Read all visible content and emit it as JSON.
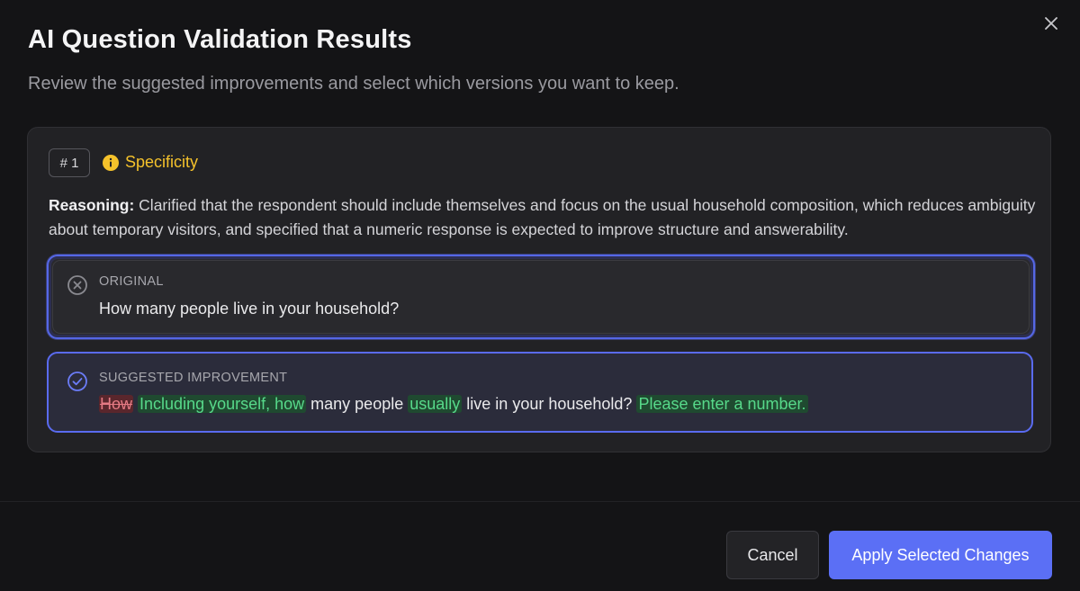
{
  "dialog": {
    "title": "AI Question Validation Results",
    "subtitle": "Review the suggested improvements and select which versions you want to keep."
  },
  "result": {
    "number": "# 1",
    "category": "Specificity",
    "reasoning_label": "Reasoning:",
    "reasoning_text": "Clarified that the respondent should include themselves and focus on the usual household composition, which reduces ambiguity about temporary visitors, and specified that a numeric response is expected to improve structure and answerability."
  },
  "original": {
    "label": "ORIGINAL",
    "text": "How many people live in your household?"
  },
  "suggested": {
    "label": "SUGGESTED IMPROVEMENT",
    "segments": {
      "removed": "How",
      "added_1": "Including yourself, how",
      "plain_1": "many people",
      "added_2": "usually",
      "plain_2": "live in your household?",
      "added_3": "Please enter a number."
    }
  },
  "footer": {
    "cancel_label": "Cancel",
    "apply_label": "Apply Selected Changes"
  },
  "colors": {
    "accent": "#5b6ff5",
    "category_yellow": "#f5c22b",
    "removed_red": "#e57a84",
    "added_green": "#57d98a"
  },
  "icons": [
    "close-icon",
    "info-icon",
    "x-circle-icon",
    "check-circle-icon"
  ]
}
